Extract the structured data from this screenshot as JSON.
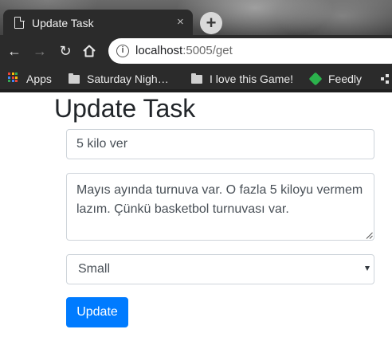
{
  "browser": {
    "tab_title": "Update Task",
    "close_glyph": "×",
    "new_tab_glyph": "+",
    "url_host": "localhost",
    "url_rest": ":5005/get",
    "bookmarks": [
      {
        "label": "Apps",
        "icon": "apps-grid-icon"
      },
      {
        "label": "Saturday Nigh…",
        "icon": "folder-icon"
      },
      {
        "label": "I love this Game!",
        "icon": "folder-icon"
      },
      {
        "label": "Feedly",
        "icon": "feedly-icon"
      }
    ]
  },
  "page": {
    "title": "Update Task",
    "task_title_value": "5 kilo ver",
    "task_description_value": "Mayıs ayında turnuva var. O fazla 5 kiloyu vermem lazım. Çünkü basketbol turnuvası var.",
    "size_selected": "Small",
    "submit_label": "Update"
  },
  "colors": {
    "primary": "#007bff",
    "text": "#212529",
    "input_border": "#ced4da"
  }
}
